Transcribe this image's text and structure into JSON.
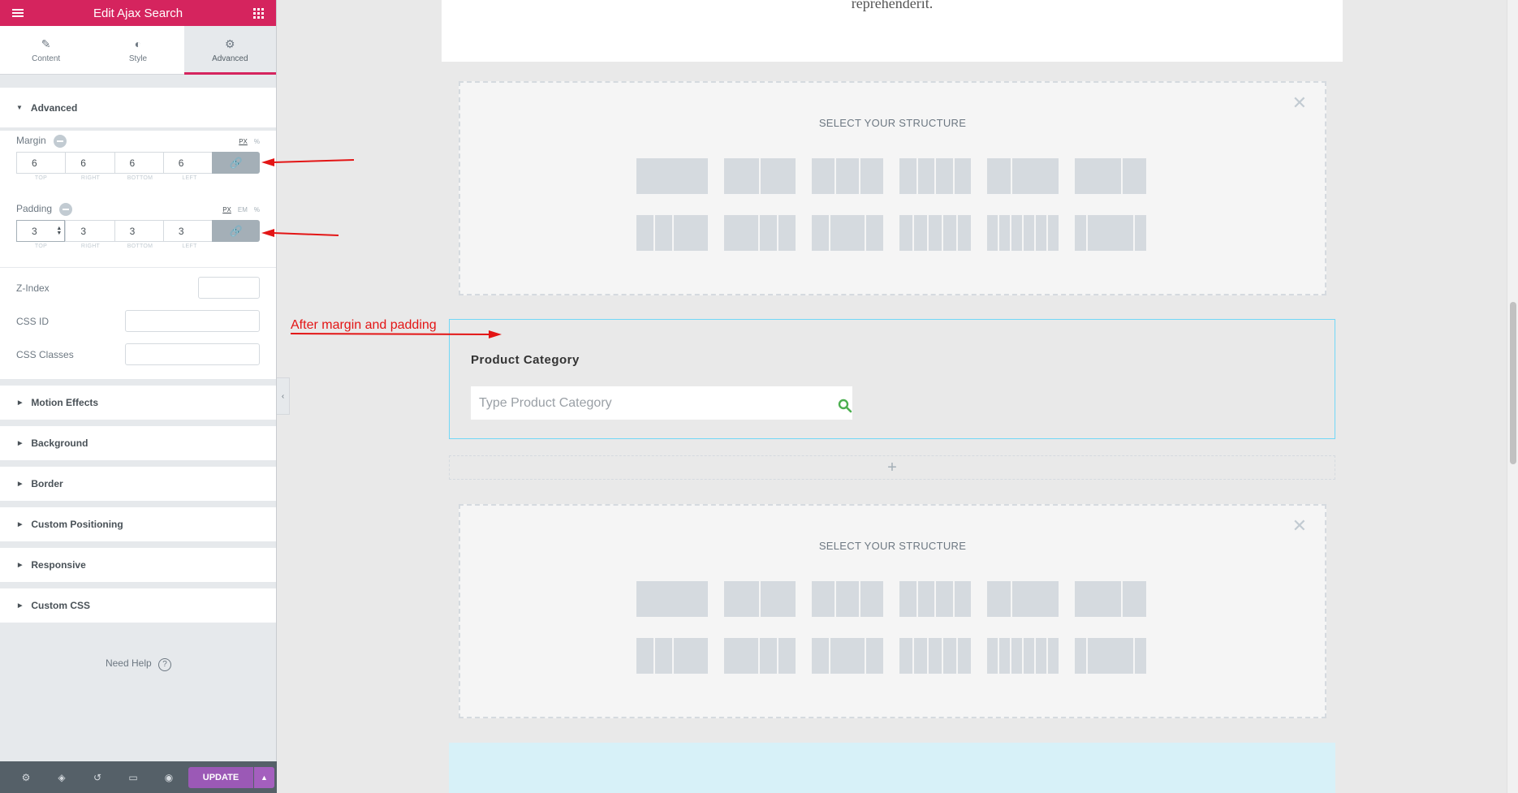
{
  "panel": {
    "title": "Edit Ajax Search",
    "tabs": [
      {
        "label": "Content",
        "icon": "pencil-icon"
      },
      {
        "label": "Style",
        "icon": "contrast-icon"
      },
      {
        "label": "Advanced",
        "icon": "gear-icon",
        "active": true
      }
    ],
    "advanced": {
      "heading": "Advanced",
      "margin": {
        "label": "Margin",
        "units": [
          "PX",
          "%"
        ],
        "active_unit": "PX",
        "values": [
          "6",
          "6",
          "6",
          "6"
        ],
        "sides": [
          "TOP",
          "RIGHT",
          "BOTTOM",
          "LEFT"
        ]
      },
      "padding": {
        "label": "Padding",
        "units": [
          "PX",
          "EM",
          "%"
        ],
        "active_unit": "PX",
        "values": [
          "3",
          "3",
          "3",
          "3"
        ],
        "sides": [
          "TOP",
          "RIGHT",
          "BOTTOM",
          "LEFT"
        ]
      },
      "z_index_label": "Z-Index",
      "css_id_label": "CSS ID",
      "css_classes_label": "CSS Classes"
    },
    "sections": [
      "Motion Effects",
      "Background",
      "Border",
      "Custom Positioning",
      "Responsive",
      "Custom CSS"
    ],
    "help": "Need Help",
    "update_label": "UPDATE",
    "accent": "#d5245e"
  },
  "canvas": {
    "top_text": "reprehenderit.",
    "structure_title": "SELECT YOUR STRUCTURE",
    "widget_title": "Product Category",
    "search_placeholder": "Type Product Category",
    "add_symbol": "+"
  },
  "annotation": {
    "note": "After margin and padding",
    "color": "#e31515"
  }
}
